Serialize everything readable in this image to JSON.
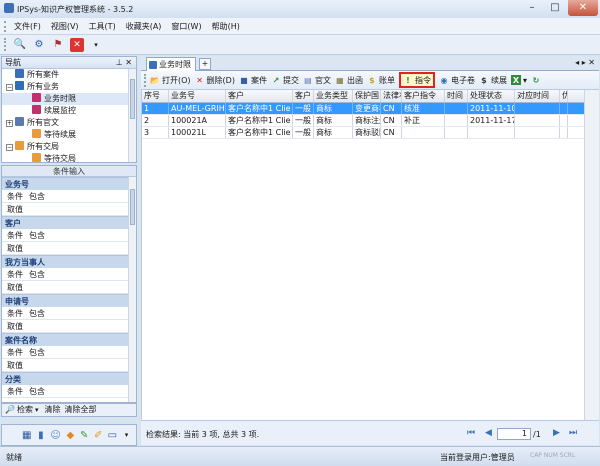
{
  "window": {
    "title": "IPSys-知识产权管理系统 - 3.5.2",
    "minimize": "–",
    "maximize": "□",
    "close": "✕"
  },
  "menu": [
    "文件(F)",
    "视图(V)",
    "工具(T)",
    "收藏夹(A)",
    "窗口(W)",
    "帮助(H)"
  ],
  "nav": {
    "title": "导航",
    "pin": "⊥ ✕",
    "items": [
      {
        "label": "所有案件",
        "level": 0,
        "expander": ""
      },
      {
        "label": "所有业务",
        "level": 0,
        "expander": "−"
      },
      {
        "label": "业务时限",
        "level": 1,
        "expander": ""
      },
      {
        "label": "续展监控",
        "level": 1,
        "expander": ""
      },
      {
        "label": "所有官文",
        "level": 0,
        "expander": "+"
      },
      {
        "label": "等待续展",
        "level": 1,
        "expander": ""
      },
      {
        "label": "所有交局",
        "level": 0,
        "expander": "−"
      },
      {
        "label": "等待交局",
        "level": 1,
        "expander": ""
      }
    ]
  },
  "conditions": {
    "title": "条件输入",
    "groups": [
      {
        "name": "业务号",
        "cond_label": "条件",
        "cond_value": "包含",
        "val_label": "取值"
      },
      {
        "name": "客户",
        "cond_label": "条件",
        "cond_value": "包含",
        "val_label": "取值"
      },
      {
        "name": "我方当事人",
        "cond_label": "条件",
        "cond_value": "包含",
        "val_label": "取值"
      },
      {
        "name": "申请号",
        "cond_label": "条件",
        "cond_value": "包含",
        "val_label": "取值"
      },
      {
        "name": "案件名称",
        "cond_label": "条件",
        "cond_value": "包含",
        "val_label": "取值"
      },
      {
        "name": "分类",
        "cond_label": "条件",
        "cond_value": "包含",
        "val_label": ""
      }
    ],
    "actions": {
      "search": "检索",
      "clear": "清除",
      "clear_all": "清除全部"
    }
  },
  "tabs": {
    "active": "业务时限"
  },
  "toolbar": [
    {
      "label": "打开(O)",
      "icon": "open-icon",
      "color": "#2f6db5"
    },
    {
      "label": "删除(D)",
      "icon": "delete-icon",
      "color": "#cc2222"
    },
    {
      "label": "案件",
      "icon": "case-icon",
      "color": "#3a5da8"
    },
    {
      "label": "提交",
      "icon": "submit-icon",
      "color": "#2f8a3a"
    },
    {
      "label": "官文",
      "icon": "document-icon",
      "color": "#5a7bb0"
    },
    {
      "label": "出函",
      "icon": "letter-icon",
      "color": "#7a6a2a"
    },
    {
      "label": "账单",
      "icon": "bill-icon",
      "color": "#c9a21c"
    },
    {
      "label": "指令",
      "icon": "instruction-icon",
      "color": "#2f8a3a"
    },
    {
      "label": "电子卷",
      "icon": "ecase-icon",
      "color": "#2f6db5"
    },
    {
      "label": "续展",
      "icon": "renew-icon",
      "color": "#333333"
    }
  ],
  "grid": {
    "columns": [
      "序号",
      "业务号",
      "客户",
      "客户",
      "业务类型",
      "保护国",
      "法律状",
      "客户指令",
      "时间",
      "处理状态",
      "对应时间",
      "优"
    ],
    "rows": [
      [
        "1",
        "AU-MEL-GRIH",
        "客户名称中1 Clie",
        "一般",
        "商标",
        "变更商标",
        "CN",
        "核准",
        "",
        "2011-11-10",
        "",
        ""
      ],
      [
        "2",
        "100021A",
        "客户名称中1 Clie",
        "一般",
        "商标",
        "商标注册",
        "CN",
        "补正",
        "",
        "2011-11-17",
        "",
        ""
      ],
      [
        "3",
        "100021L",
        "客户名称中1 Clie",
        "一般",
        "商标",
        "商标驳回",
        "CN",
        "",
        "",
        "",
        "",
        ""
      ]
    ]
  },
  "footer": {
    "result_text": "检索结果: 当前 3 项, 总共 3 项.",
    "page_current": "1",
    "page_total": "/1"
  },
  "status": {
    "left": "就绪",
    "user": "当前登录用户:管理员",
    "keys": "CAP  NUM  SCRL"
  }
}
